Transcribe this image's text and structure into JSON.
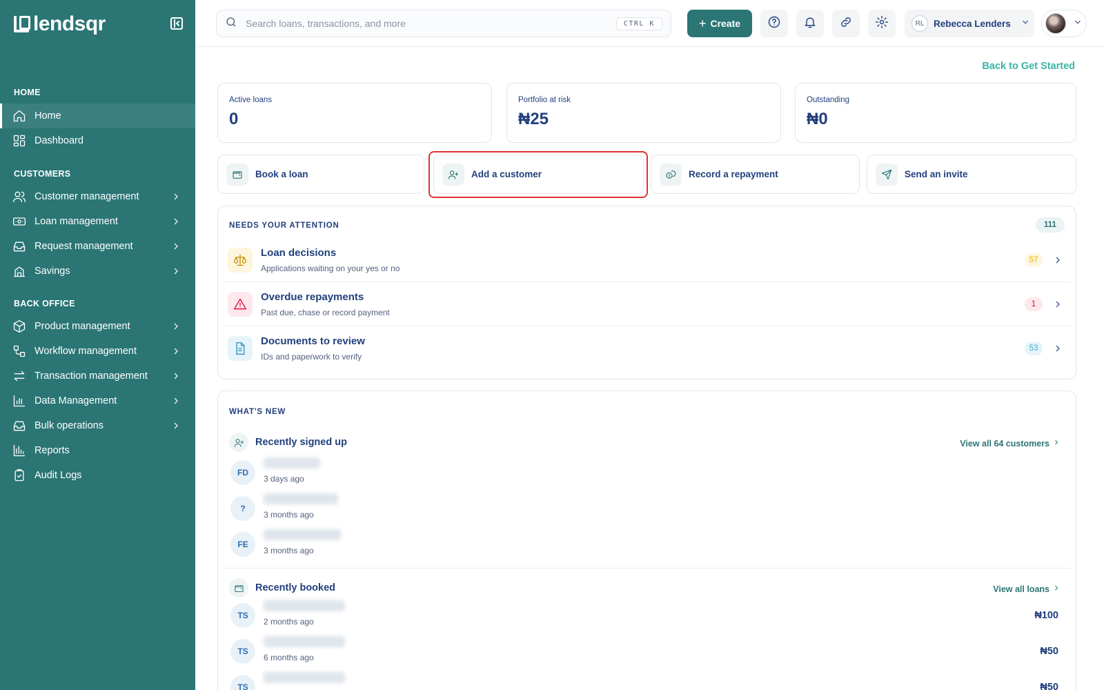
{
  "brand": {
    "name": "lendsqr"
  },
  "sidebar": {
    "sections": {
      "home": "HOME",
      "customers": "CUSTOMERS",
      "back_office": "BACK OFFICE"
    },
    "items": [
      {
        "label": "Home",
        "icon": "home-icon"
      },
      {
        "label": "Dashboard",
        "icon": "dashboard-icon"
      },
      {
        "label": "Customer management",
        "icon": "users-icon"
      },
      {
        "label": "Loan management",
        "icon": "loan-icon"
      },
      {
        "label": "Request management",
        "icon": "inbox-icon"
      },
      {
        "label": "Savings",
        "icon": "savings-icon"
      },
      {
        "label": "Product management",
        "icon": "box-icon"
      },
      {
        "label": "Workflow management",
        "icon": "workflow-icon"
      },
      {
        "label": "Transaction management",
        "icon": "transfer-icon"
      },
      {
        "label": "Data Management",
        "icon": "chart-icon"
      },
      {
        "label": "Bulk operations",
        "icon": "inbox-icon"
      },
      {
        "label": "Reports",
        "icon": "reports-icon"
      },
      {
        "label": "Audit Logs",
        "icon": "clipboard-icon"
      }
    ]
  },
  "topbar": {
    "search_placeholder": "Search loans, transactions, and more",
    "shortcut": "CTRL K",
    "create_label": "Create",
    "user_initials": "RL",
    "user_name": "Rebecca Lenders"
  },
  "main": {
    "back_link": "Back to Get Started",
    "stats": [
      {
        "label": "Active loans",
        "value": "0"
      },
      {
        "label": "Portfolio at risk",
        "value": "₦25"
      },
      {
        "label": "Outstanding",
        "value": "₦0"
      }
    ],
    "actions": [
      {
        "label": "Book a loan",
        "icon": "wallet-icon"
      },
      {
        "label": "Add a customer",
        "icon": "user-plus-icon"
      },
      {
        "label": "Record a repayment",
        "icon": "coins-icon"
      },
      {
        "label": "Send an invite",
        "icon": "send-icon"
      }
    ],
    "attention": {
      "title": "NEEDS YOUR ATTENTION",
      "count": "111",
      "items": [
        {
          "title": "Loan decisions",
          "subtitle": "Applications waiting on your yes or no",
          "count": "57",
          "icon": "scale-icon",
          "color": "#e9b200"
        },
        {
          "title": "Overdue repayments",
          "subtitle": "Past due, chase or record payment",
          "count": "1",
          "icon": "warning-icon",
          "color": "#e4033b"
        },
        {
          "title": "Documents to review",
          "subtitle": "IDs and paperwork to verify",
          "count": "53",
          "icon": "document-icon",
          "color": "#39a7cd"
        }
      ]
    },
    "whats_new": {
      "title": "WHAT'S NEW",
      "signed_up": {
        "title": "Recently signed up",
        "link": "View all 64 customers",
        "people": [
          {
            "initials": "FD",
            "time": "3 days ago"
          },
          {
            "initials": "?",
            "time": "3 months ago"
          },
          {
            "initials": "FE",
            "time": "3 months ago"
          }
        ]
      },
      "booked": {
        "title": "Recently booked",
        "link": "View all loans",
        "loans": [
          {
            "initials": "TS",
            "time": "2 months ago",
            "amount": "₦100"
          },
          {
            "initials": "TS",
            "time": "6 months ago",
            "amount": "₦50"
          },
          {
            "initials": "TS",
            "time": "",
            "amount": "₦50"
          }
        ]
      }
    }
  }
}
